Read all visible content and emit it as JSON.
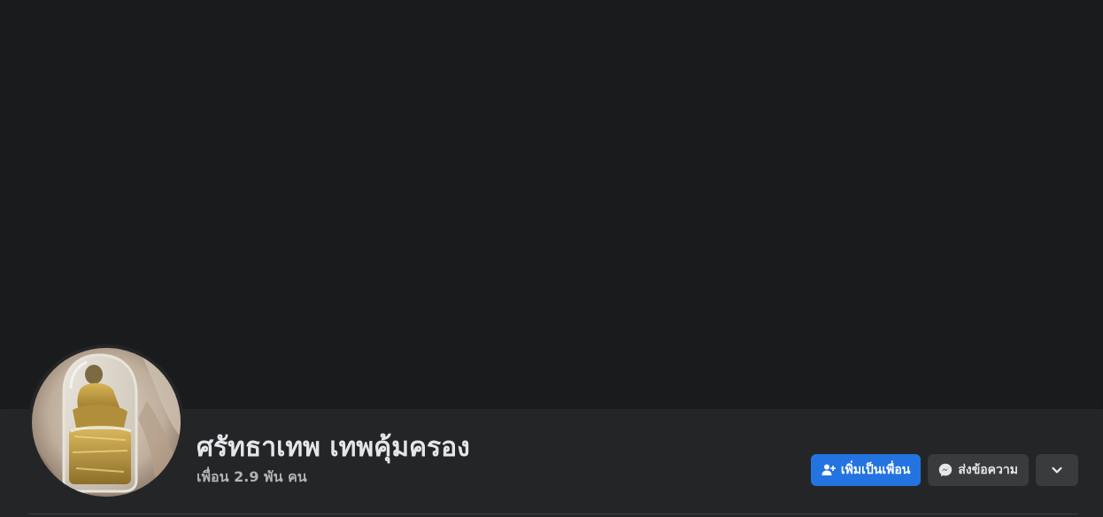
{
  "profile": {
    "name": "ศรัทธาเทพ เทพคุ้มครอง",
    "friends_count": "เพื่อน 2.9 พัน คน",
    "avatar_alt": "amulet-photo"
  },
  "actions": {
    "add_friend_label": "เพิ่มเป็นเพื่อน",
    "message_label": "ส่งข้อความ",
    "more_icon": "chevron-down-icon"
  },
  "colors": {
    "background": "#18191a",
    "surface": "#242526",
    "primary": "#2374e1",
    "secondary_button": "#3a3b3c",
    "text_primary": "#e4e6eb",
    "text_secondary": "#b0b3b8"
  }
}
